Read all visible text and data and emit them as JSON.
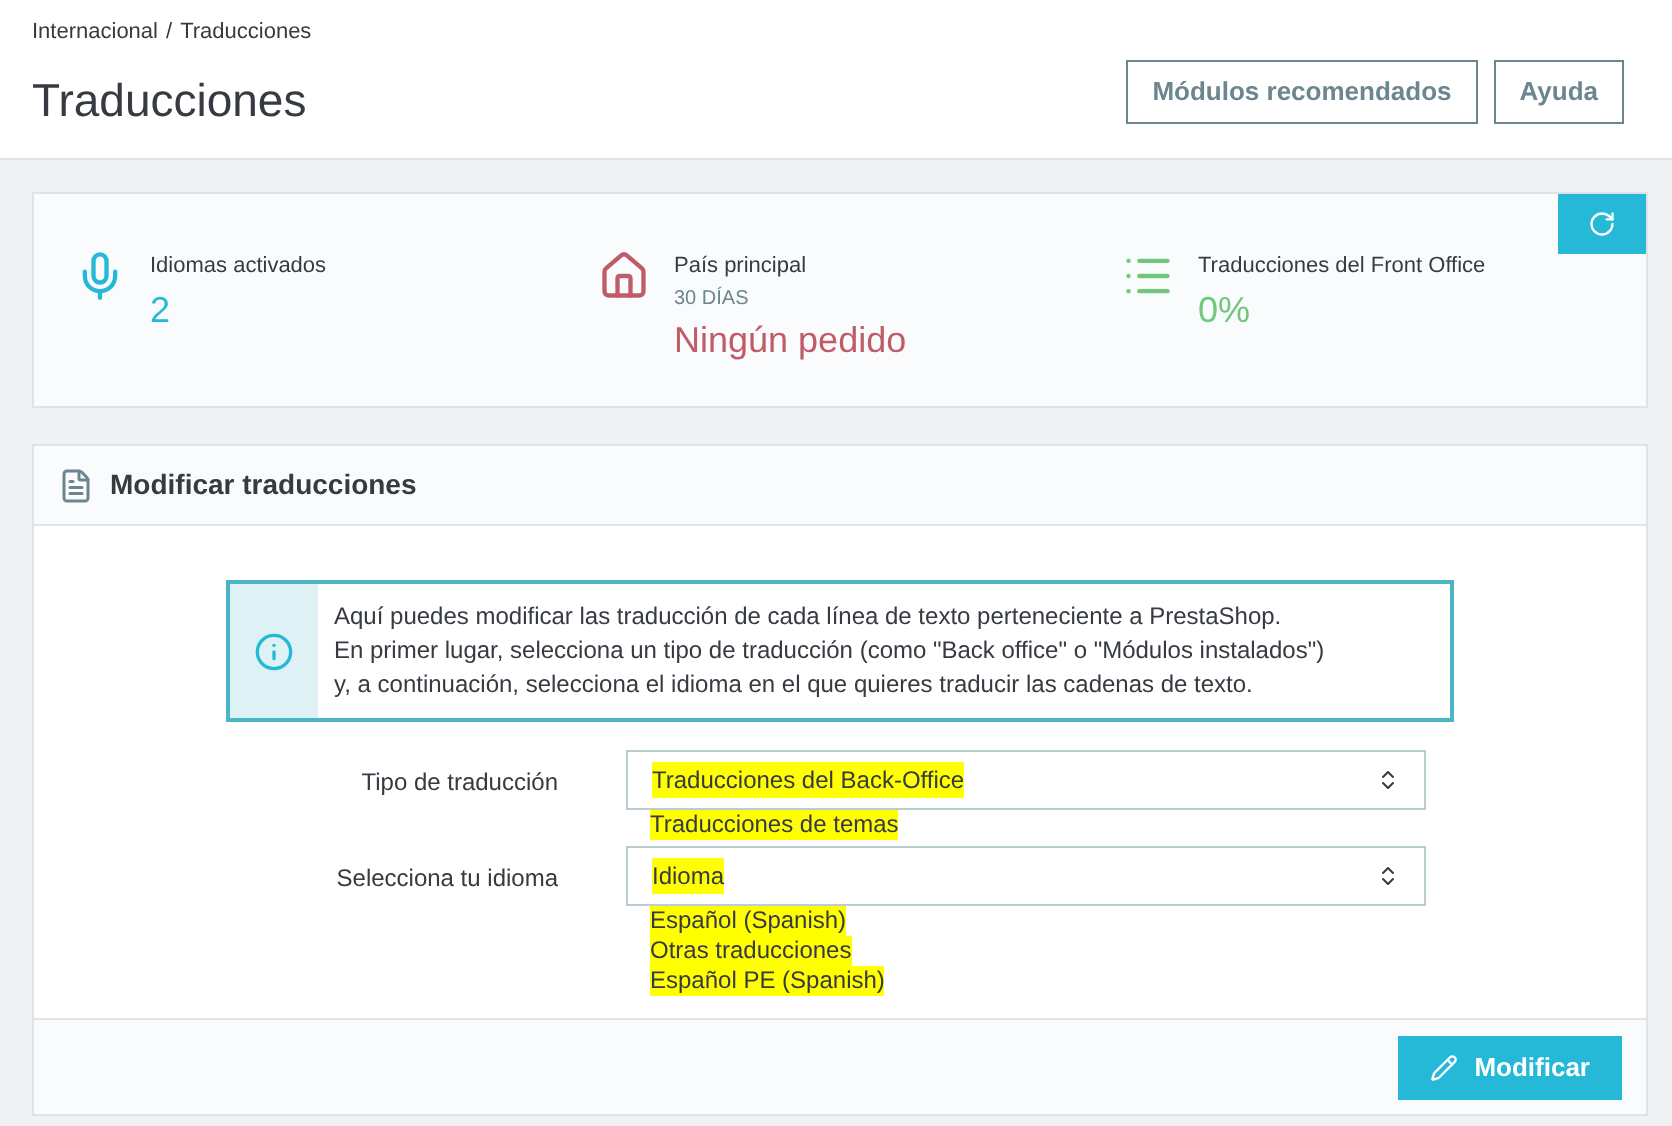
{
  "breadcrumb": [
    "Internacional",
    "Traducciones"
  ],
  "breadcrumb_separator": "/",
  "title": "Traducciones",
  "header_buttons": [
    "Módulos recomendados",
    "Ayuda"
  ],
  "stats": [
    {
      "kind": "microphone",
      "label": "Idiomas activados",
      "value": "2",
      "color": "#25b9d7"
    },
    {
      "kind": "home",
      "label": "País principal",
      "sublabel": "30 DÍAS",
      "value": "Ningún pedido",
      "color": "#c05c67"
    },
    {
      "kind": "list",
      "label": "Traducciones del Front Office",
      "value": "0%",
      "color": "#70c97a"
    }
  ],
  "panel": {
    "title": "Modificar traducciones",
    "info_lines": [
      "Aquí puedes modificar las traducción de cada línea de texto perteneciente a PrestaShop.",
      "En primer lugar, selecciona un tipo de traducción (como \"Back office\" o \"Módulos instalados\")",
      "y, a continuación, selecciona el idioma en el que quieres traducir las cadenas de texto."
    ],
    "fields": [
      {
        "label": "Tipo de traducción",
        "value": "Traducciones del Back-Office",
        "highlighted": true,
        "option_texts": [
          {
            "text": "Traducciones de temas",
            "highlighted": true
          }
        ]
      },
      {
        "label": "Selecciona tu idioma",
        "value": "Idioma",
        "highlighted": true,
        "option_texts": [
          {
            "text": "Español (Spanish)",
            "highlighted": true
          },
          {
            "text": "Otras traducciones",
            "highlighted": true
          },
          {
            "text": "Español PE (Spanish)",
            "highlighted": true
          }
        ]
      }
    ],
    "submit": "Modificar"
  }
}
